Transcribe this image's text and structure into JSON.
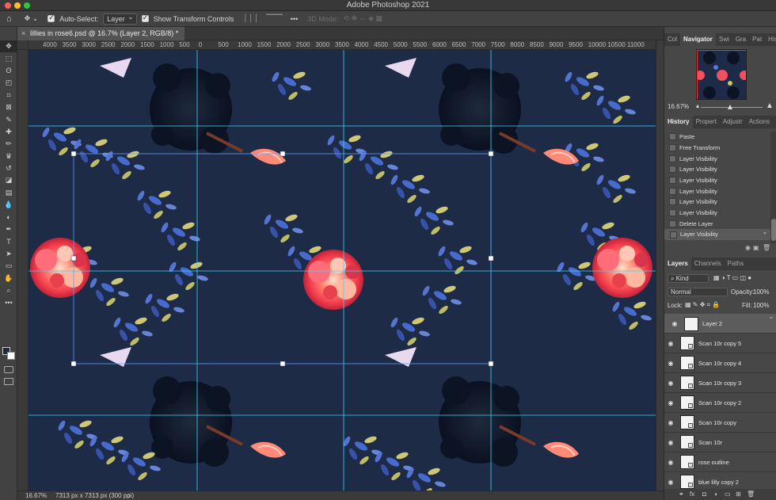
{
  "app": {
    "title": "Adobe Photoshop 2021",
    "traffic_colors": [
      "#ff5f57",
      "#febc2e",
      "#28c840"
    ]
  },
  "options_bar": {
    "home_icon": "home-icon",
    "move_icon": "move-tool-icon",
    "auto_select_label": "Auto-Select:",
    "auto_select_value": "Layer",
    "show_transform_label": "Show Transform Controls",
    "mode_3d_label": "3D Mode:",
    "more_label": "•••"
  },
  "document": {
    "tab_title": "lillies in rose6.psd @ 16.7% (Layer 2, RGB/8) *",
    "close_glyph": "×",
    "zoom": "16.67%",
    "size_info": "7313 px x 7313 px (300 ppi)",
    "canvas_color": "#1d2b47",
    "guide_color": "#3ad6ff",
    "ruler_labels": [
      "4000",
      "3500",
      "3000",
      "2500",
      "2000",
      "1500",
      "1000",
      "500",
      "0",
      "500",
      "1000",
      "1500",
      "2000",
      "2500",
      "3000",
      "3500",
      "4000",
      "4500",
      "5000",
      "5500",
      "6000",
      "6500",
      "7000",
      "7500",
      "8000",
      "8500",
      "9000",
      "9500",
      "10000",
      "10500",
      "11000"
    ]
  },
  "toolbar": {
    "tools": [
      "move-tool-icon",
      "marquee-tool-icon",
      "lasso-tool-icon",
      "object-select-tool-icon",
      "crop-tool-icon",
      "frame-tool-icon",
      "eyedropper-tool-icon",
      "healing-brush-icon",
      "brush-tool-icon",
      "clone-stamp-icon",
      "history-brush-icon",
      "eraser-tool-icon",
      "gradient-tool-icon",
      "blur-tool-icon",
      "dodge-tool-icon",
      "pen-tool-icon",
      "type-tool-icon",
      "path-select-tool-icon",
      "rectangle-tool-icon",
      "hand-tool-icon",
      "zoom-tool-icon",
      "more-tools-icon"
    ],
    "glyphs": [
      "✥",
      "⬚",
      "ʘ",
      "◰",
      "⌗",
      "⊠",
      "✎",
      "✚",
      "✏",
      "♛",
      "↺",
      "◪",
      "▤",
      "💧",
      "◐",
      "✒",
      "T",
      "➤",
      "▭",
      "✋",
      "⌕",
      "•••"
    ]
  },
  "navigator_panel": {
    "tabs": [
      "Col",
      "Navigator",
      "Swi",
      "Gra",
      "Pat",
      "His"
    ],
    "zoom": "16.67%"
  },
  "history_panel": {
    "tabs": [
      "History",
      "Propert",
      "Adjustr",
      "Actions"
    ],
    "items": [
      "Paste",
      "Free Transform",
      "Layer Visibility",
      "Layer Visibility",
      "Layer Visibility",
      "Layer Visibility",
      "Layer Visibility",
      "Layer Visibility",
      "Delete Layer",
      "Layer Visibility"
    ]
  },
  "layers_panel": {
    "tabs": [
      "Layers",
      "Channels",
      "Paths"
    ],
    "filter_label": "Kind",
    "blend_mode": "Normal",
    "opacity_label": "Opacity:",
    "opacity_value": "100%",
    "lock_label": "Lock:",
    "fill_label": "Fill:",
    "fill_value": "100%",
    "layers": [
      "Layer 2",
      "Scan 10r copy 5",
      "Scan 10r copy 4",
      "Scan 10r copy 3",
      "Scan 10r copy 2",
      "Scan 10r copy",
      "Scan 10r",
      "rose outline",
      "blue lilly copy 2"
    ]
  }
}
